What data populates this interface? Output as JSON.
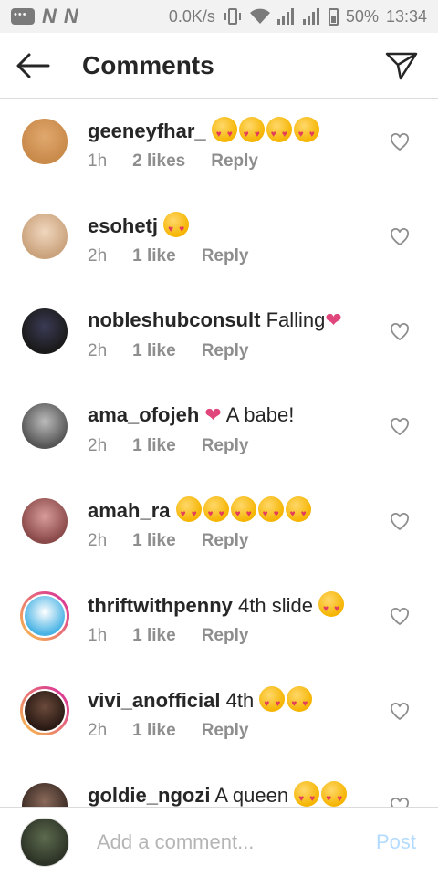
{
  "status_bar": {
    "carrier_icons": [
      "N",
      "N"
    ],
    "speed": "0.0K/s",
    "battery": "50%",
    "time": "13:34"
  },
  "header": {
    "title": "Comments"
  },
  "comments": [
    {
      "username": "geeneyfhar_",
      "text": "",
      "emoji_count": 4,
      "time": "1h",
      "likes": "2 likes",
      "reply": "Reply",
      "avatar_colors": [
        "#c98a4a",
        "#e0a86e"
      ]
    },
    {
      "username": "esohetj",
      "text": "",
      "emoji_count": 1,
      "time": "2h",
      "likes": "1 like",
      "reply": "Reply",
      "avatar_colors": [
        "#caa27c",
        "#f0d7be"
      ]
    },
    {
      "username": "nobleshubconsult",
      "text": "Falling",
      "pink_heart": true,
      "emoji_count": 0,
      "time": "2h",
      "likes": "1 like",
      "reply": "Reply",
      "avatar_colors": [
        "#1a1a1a",
        "#3a3a55"
      ]
    },
    {
      "username": "ama_ofojeh",
      "text": "A babe!",
      "pink_heart_before": true,
      "emoji_count": 0,
      "time": "2h",
      "likes": "1 like",
      "reply": "Reply",
      "avatar_colors": [
        "#555555",
        "#bbbbbb"
      ]
    },
    {
      "username": "amah_ra",
      "text": "",
      "emoji_count": 5,
      "time": "2h",
      "likes": "1 like",
      "reply": "Reply",
      "avatar_colors": [
        "#8a4a4a",
        "#d99a9a"
      ]
    },
    {
      "username": "thriftwithpenny",
      "text": "4th slide",
      "emoji_count": 1,
      "time": "1h",
      "likes": "1 like",
      "reply": "Reply",
      "avatar_colors": [
        "#49b3e5",
        "#ffffff"
      ],
      "ring": true
    },
    {
      "username": "vivi_anofficial",
      "text": "4th",
      "emoji_count": 2,
      "time": "2h",
      "likes": "1 like",
      "reply": "Reply",
      "avatar_colors": [
        "#2a1a14",
        "#6b4a3a"
      ],
      "ring": true
    },
    {
      "username": "goldie_ngozi",
      "text": "A queen",
      "emoji_count": 2,
      "time": "",
      "likes": "",
      "reply": "",
      "avatar_colors": [
        "#3a2a24",
        "#8a6a5a"
      ]
    }
  ],
  "composer": {
    "placeholder": "Add a comment...",
    "post_label": "Post"
  },
  "colors": {
    "text_primary": "#262626",
    "text_secondary": "#8e8e8e",
    "post_disabled": "#b3dbff",
    "pink_heart": "#e0457b",
    "story_ring": "#d6249f"
  }
}
